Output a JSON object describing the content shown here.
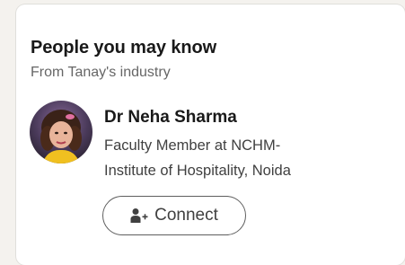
{
  "card": {
    "heading": "People you may know",
    "subheading": "From Tanay's industry"
  },
  "person": {
    "name": "Dr Neha Sharma",
    "title_line1": "Faculty Member at NCHM-",
    "title_line2": "Institute of Hospitality, Noida",
    "avatar_icon": "profile-photo"
  },
  "actions": {
    "connect_label": "Connect",
    "connect_icon": "add-person-icon"
  },
  "colors": {
    "card_bg": "#ffffff",
    "page_bg": "#f4f2ee",
    "text_primary": "#191919",
    "text_secondary": "#666666",
    "button_border": "#5e5e5e"
  }
}
